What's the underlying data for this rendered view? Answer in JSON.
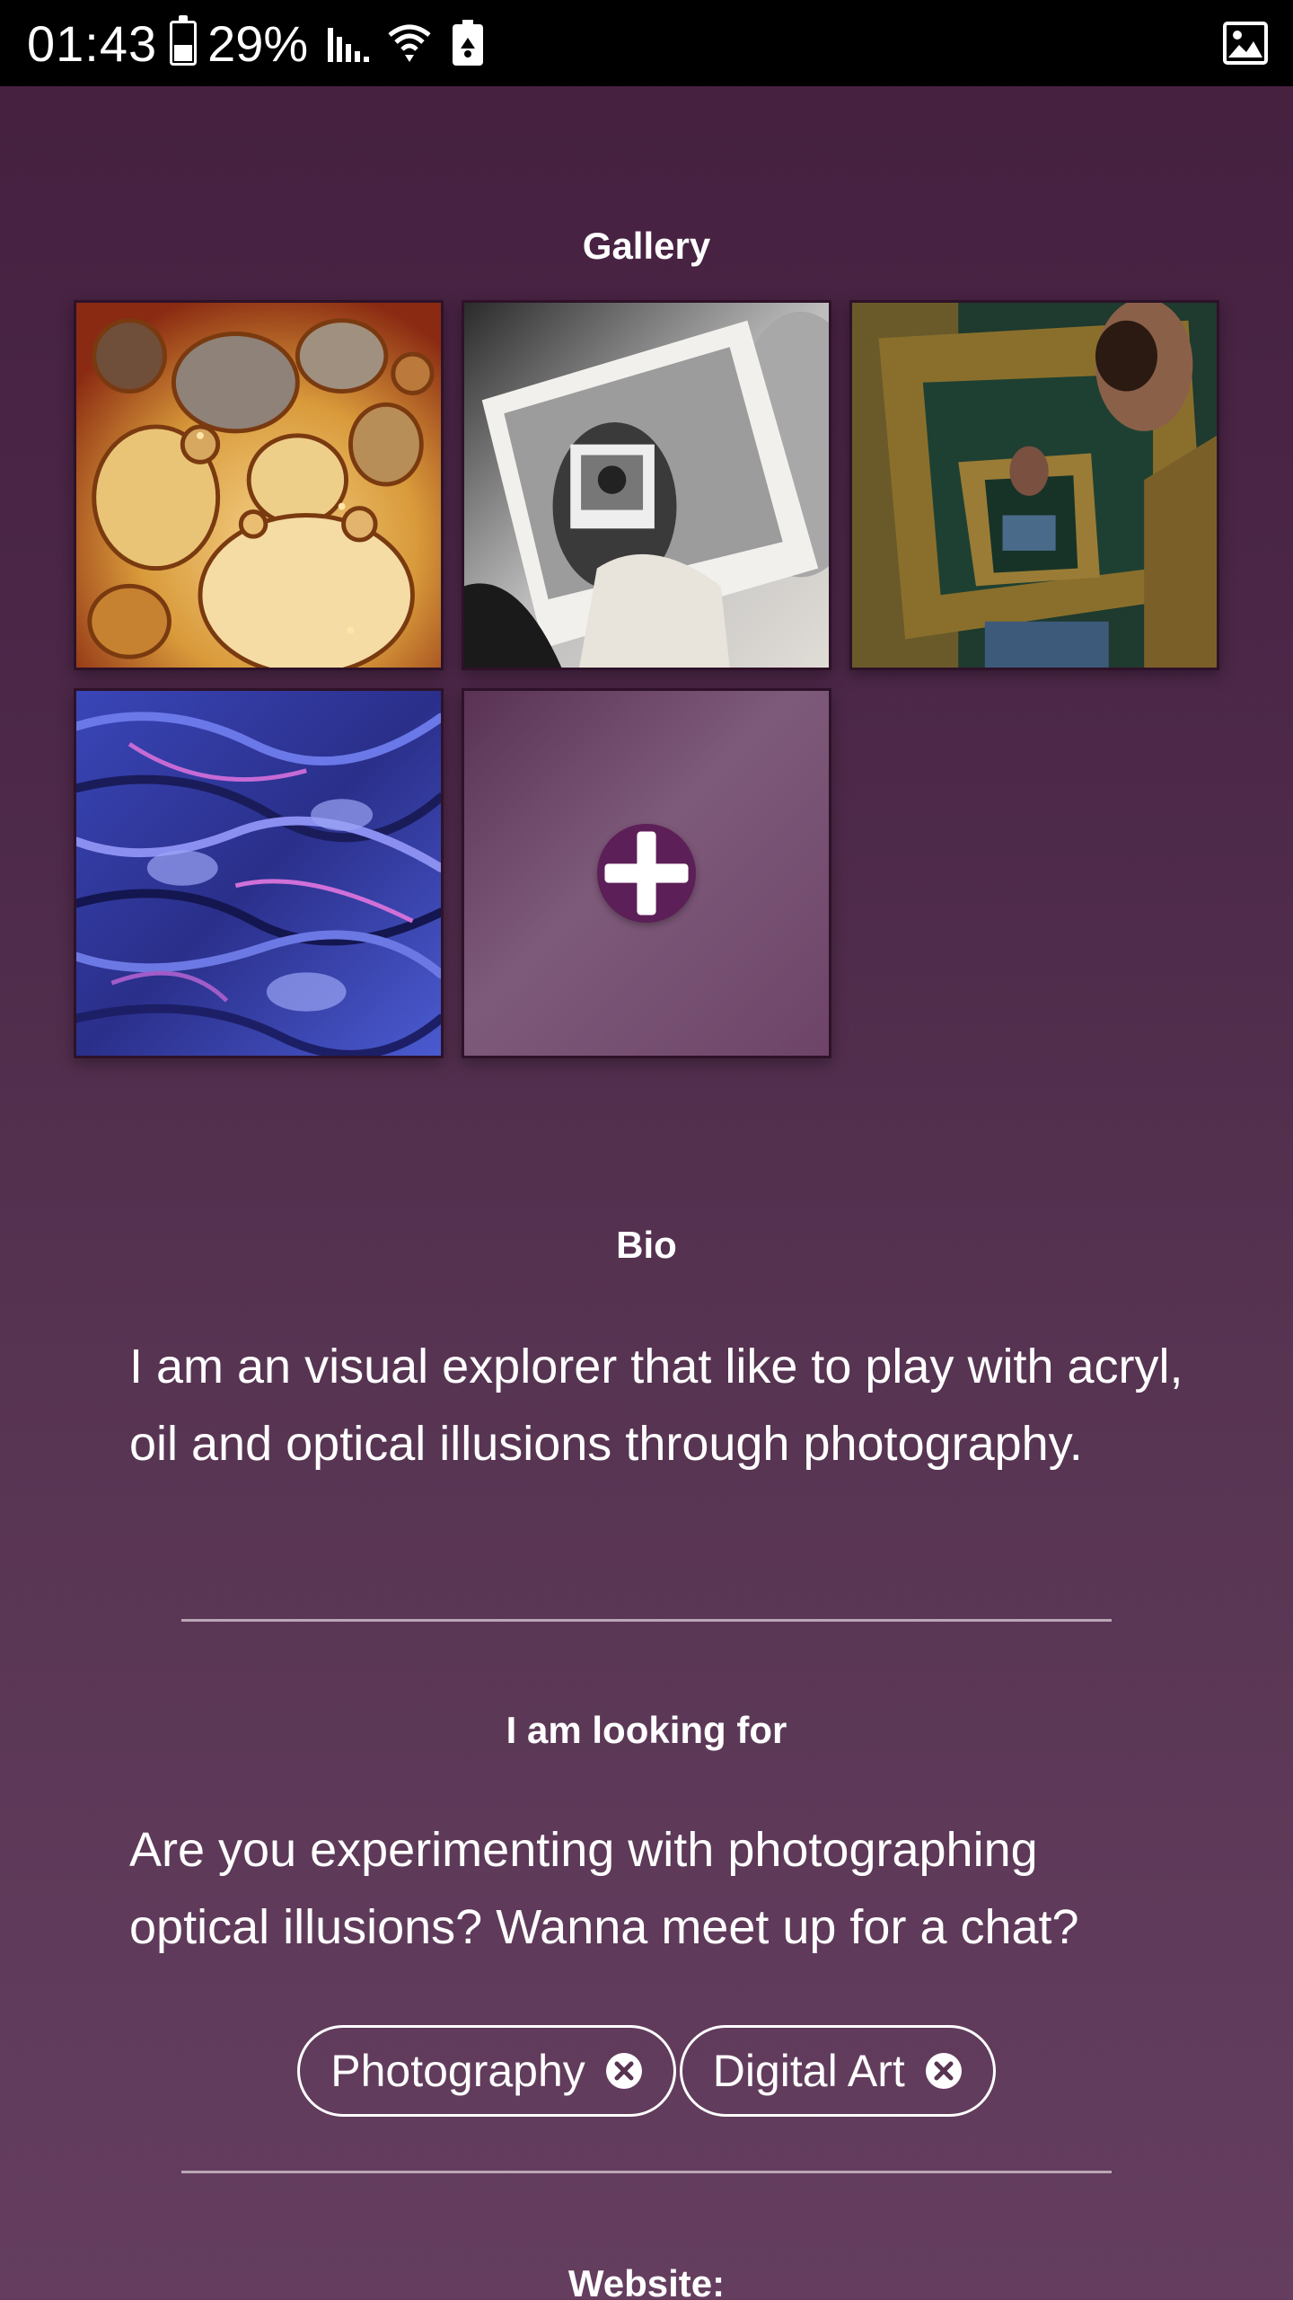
{
  "status_bar": {
    "time": "01:43",
    "battery": "29%",
    "icons": [
      "battery-icon",
      "signal-icon",
      "wifi-icon",
      "recycle-battery-icon",
      "image-icon"
    ]
  },
  "gallery": {
    "title": "Gallery",
    "images": [
      {
        "name": "oil-bubbles-image"
      },
      {
        "name": "polaroid-recursion-image"
      },
      {
        "name": "frame-recursion-image"
      },
      {
        "name": "blue-paint-texture-image"
      }
    ],
    "add_icon": "plus-icon"
  },
  "bio": {
    "title": "Bio",
    "text": "I am an visual explorer that like to play with acryl, oil and optical illusions through photography."
  },
  "looking_for": {
    "title": "I am looking for",
    "text": "Are you experimenting with photographing optical illusions? Wanna meet up for a chat?"
  },
  "tags": [
    {
      "label": "Photography"
    },
    {
      "label": "Digital Art"
    }
  ],
  "website": {
    "title": "Website:"
  },
  "colors": {
    "background_top": "#45203f",
    "background_bottom": "#653e5f",
    "add_button": "#5d1f57",
    "divider": "#b9a6b6"
  }
}
